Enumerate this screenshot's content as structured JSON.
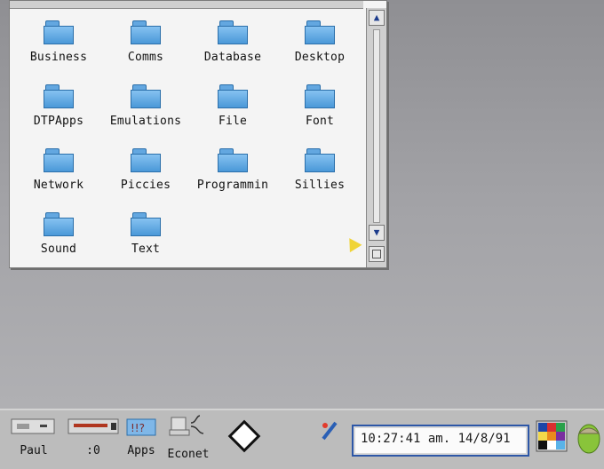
{
  "filer": {
    "items": [
      {
        "label": "Business"
      },
      {
        "label": "Comms"
      },
      {
        "label": "Database"
      },
      {
        "label": "Desktop"
      },
      {
        "label": "DTPApps"
      },
      {
        "label": "Emulations"
      },
      {
        "label": "File"
      },
      {
        "label": "Font"
      },
      {
        "label": "Network"
      },
      {
        "label": "Piccies"
      },
      {
        "label": "Programmin"
      },
      {
        "label": "Sillies"
      },
      {
        "label": "Sound"
      },
      {
        "label": "Text"
      }
    ],
    "scroll": {
      "up_icon": "triangle-up-icon",
      "down_icon": "triangle-down-icon",
      "resize_icon": "resize-icon"
    }
  },
  "iconbar": {
    "items": [
      {
        "label": "Paul",
        "icon": "disc-drive-icon"
      },
      {
        "label": ":0",
        "icon": "hard-disc-icon"
      },
      {
        "label": "Apps",
        "icon": "apps-folder-icon"
      },
      {
        "label": "Econet",
        "icon": "econet-computer-icon"
      }
    ],
    "clock_text": "10:27:41 am. 14/8/91",
    "pen_icon": "edit-pen-icon",
    "diamond_icon": "diamond-icon",
    "palette_icon": "palette-icon",
    "acorn_icon": "acorn-icon"
  }
}
